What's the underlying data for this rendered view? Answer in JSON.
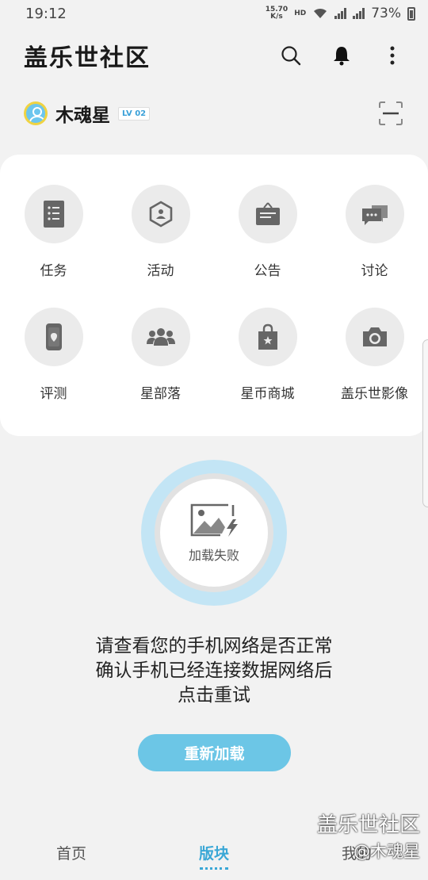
{
  "status": {
    "time": "19:12",
    "speed_value": "15.70",
    "speed_unit": "K/s",
    "hd": "HD",
    "battery": "73%"
  },
  "header": {
    "title": "盖乐世社区",
    "icons": [
      "search-icon",
      "bell-icon",
      "more-vertical-icon"
    ]
  },
  "user": {
    "name": "木魂星",
    "level": "LV 02"
  },
  "grid": [
    {
      "label": "任务",
      "icon": "task-list-icon"
    },
    {
      "label": "活动",
      "icon": "activity-hexagon-icon"
    },
    {
      "label": "公告",
      "icon": "notice-board-icon"
    },
    {
      "label": "讨论",
      "icon": "chat-bubbles-icon"
    },
    {
      "label": "评测",
      "icon": "phone-review-icon"
    },
    {
      "label": "星部落",
      "icon": "group-icon"
    },
    {
      "label": "星币商城",
      "icon": "shopping-bag-icon"
    },
    {
      "label": "盖乐世影像",
      "icon": "camera-icon"
    }
  ],
  "load_error": {
    "badge": "加载失败",
    "lines": [
      "请查看您的手机网络是否正常",
      "确认手机已经连接数据网络后",
      "点击重试"
    ],
    "button": "重新加载"
  },
  "nav": {
    "items": [
      "首页",
      "版块",
      "我的"
    ],
    "active": "版块"
  },
  "watermark": {
    "line1": "盖乐世社区",
    "line2": "@木魂星"
  },
  "colors": {
    "accent": "#6cc6e6",
    "active_nav": "#3aa7d6",
    "ring": "#c3e5f5"
  }
}
